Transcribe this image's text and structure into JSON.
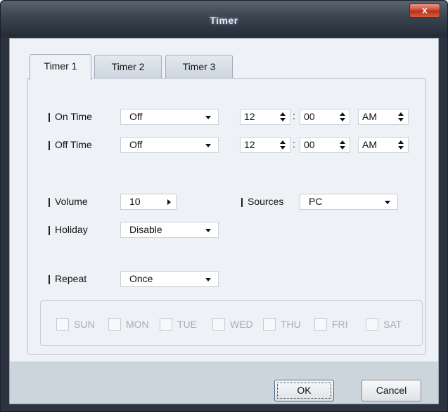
{
  "window": {
    "title": "Timer",
    "close_glyph": "x"
  },
  "tabs": [
    {
      "label": "Timer 1",
      "active": true
    },
    {
      "label": "Timer 2",
      "active": false
    },
    {
      "label": "Timer 3",
      "active": false
    }
  ],
  "on_time": {
    "label": "On Time",
    "mode": "Off",
    "hour": "12",
    "minute": "00",
    "ampm": "AM"
  },
  "off_time": {
    "label": "Off Time",
    "mode": "Off",
    "hour": "12",
    "minute": "00",
    "ampm": "AM"
  },
  "time_separator": ":",
  "volume": {
    "label": "Volume",
    "value": "10"
  },
  "sources": {
    "label": "Sources",
    "value": "PC"
  },
  "holiday": {
    "label": "Holiday",
    "value": "Disable"
  },
  "repeat": {
    "label": "Repeat",
    "value": "Once"
  },
  "days": [
    "SUN",
    "MON",
    "TUE",
    "WED",
    "THU",
    "FRI",
    "SAT"
  ],
  "buttons": {
    "ok": "OK",
    "cancel": "Cancel"
  },
  "colors": {
    "titlebar": "#2b3440",
    "panel": "#eef1f5",
    "footer": "#ccd4dc",
    "close": "#c9452f",
    "disabled_text": "#a7aeb6"
  }
}
